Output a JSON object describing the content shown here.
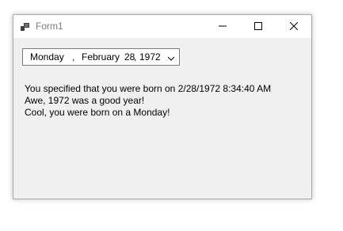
{
  "window": {
    "title": "Form1"
  },
  "datepicker": {
    "day_of_week": "Monday",
    "separator1": ",",
    "month": "February",
    "day": "28",
    "separator2": ",",
    "year": "1972"
  },
  "messages": [
    "You specified that you were born on 2/28/1972 8:34:40 AM",
    "Awe, 1972 was a good year!",
    "Cool, you were born on a Monday!"
  ],
  "icons": {
    "app": "winforms-app-icon",
    "minimize": "minimize-icon",
    "maximize": "maximize-icon",
    "close": "close-icon",
    "dropdown": "chevron-down-icon"
  }
}
